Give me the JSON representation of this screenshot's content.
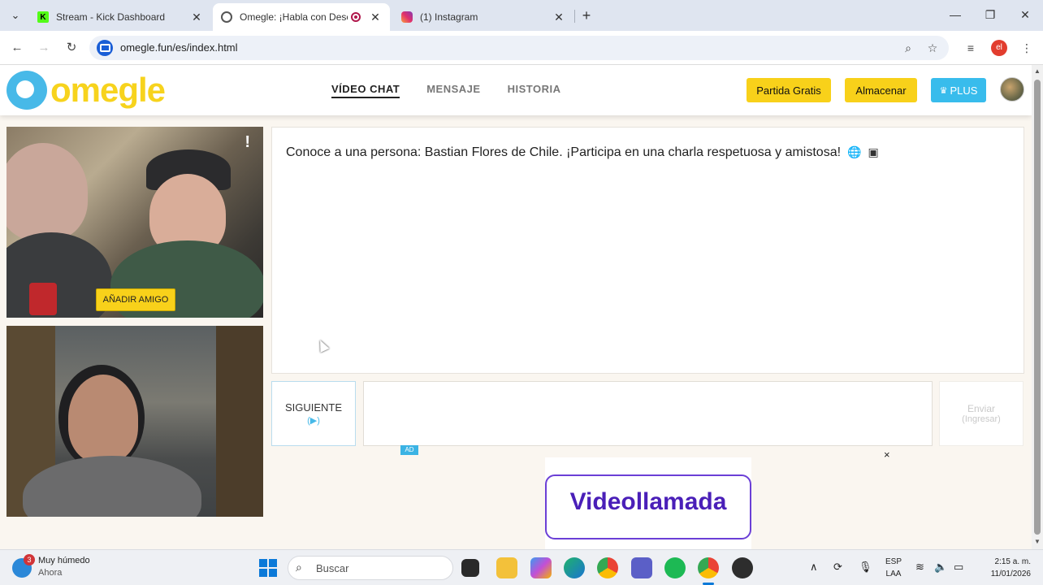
{
  "browser": {
    "tabs": [
      {
        "title": "Stream - Kick Dashboard",
        "favicon": "kick-icon",
        "color": "#53fc18"
      },
      {
        "title": "Omegle: ¡Habla con Descon",
        "favicon": "globe-icon",
        "color": "#555555",
        "active": true
      },
      {
        "title": "(1) Instagram",
        "favicon": "instagram-icon",
        "color": "#e1306c"
      }
    ],
    "url": "omegle.fun/es/index.html",
    "profile_initials": "el"
  },
  "site": {
    "logo_text": "omegle",
    "nav": [
      {
        "label": "VÍDEO CHAT",
        "active": true
      },
      {
        "label": "MENSAJE"
      },
      {
        "label": "HISTORIA"
      }
    ],
    "buttons": {
      "free_match": "Partida Gratis",
      "store": "Almacenar",
      "plus": "PLUS"
    }
  },
  "video": {
    "add_friend": "AÑADIR AMIGO",
    "report_glyph": "!"
  },
  "chat": {
    "message": "Conoce a una persona: Bastian Flores de Chile. ¡Participa en una charla respetuosa y amistosa!",
    "next_label": "SIGUIENTE",
    "next_key": "(▶)",
    "send_label": "Enviar",
    "send_key": "(Ingresar)"
  },
  "ad": {
    "badge": "AD",
    "close": "×",
    "text": "Videollamada"
  },
  "taskbar": {
    "weather_badge": "3",
    "weather_title": "Muy húmedo",
    "weather_sub": "Ahora",
    "search_placeholder": "Buscar",
    "lang_line1": "ESP",
    "lang_line2": "LAA",
    "time": "2:15 a. m.",
    "date": "11/01/2026"
  },
  "colors": {
    "brand_yellow": "#f8d11a",
    "brand_blue": "#47b9e8",
    "plus_blue": "#38bcec"
  }
}
